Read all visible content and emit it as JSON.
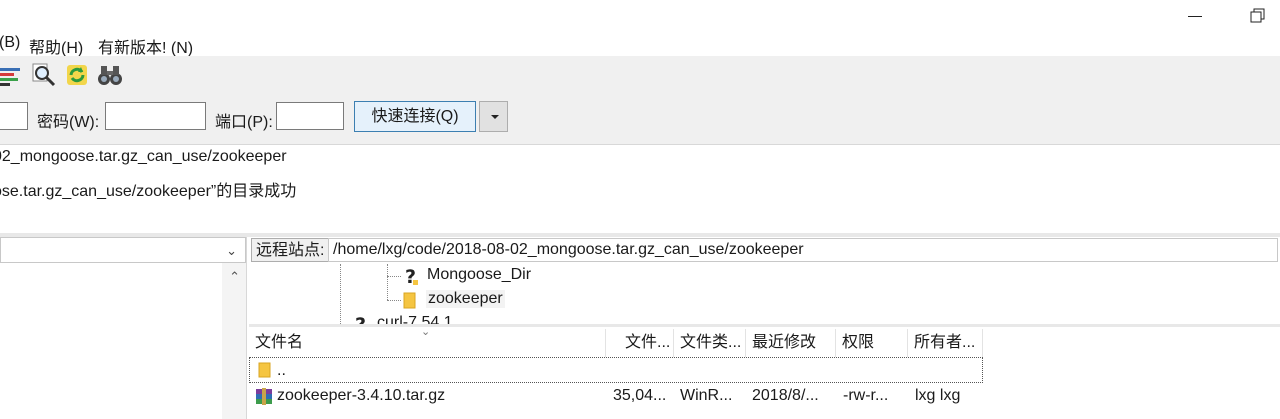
{
  "menu": {
    "items": [
      "(B)",
      "帮助(H)",
      "有新版本! (N)"
    ]
  },
  "toolbar": {
    "icons": [
      "filter-list-icon",
      "search-remote-icon",
      "refresh-icon",
      "find-binoculars-icon"
    ]
  },
  "quickconnect": {
    "password_label": "密码(W):",
    "port_label": "端口(P):",
    "connect_label": "快速连接(Q)",
    "host_value": "",
    "password_value": "",
    "port_value": ""
  },
  "log": {
    "lines": [
      "02_mongoose.tar.gz_can_use/zookeeper",
      "ose.tar.gz_can_use/zookeeper”的目录成功"
    ]
  },
  "remote": {
    "site_label": "远程站点:",
    "path": "/home/lxg/code/2018-08-02_mongoose.tar.gz_can_use/zookeeper",
    "tree": {
      "items": [
        {
          "label": "Mongoose_Dir",
          "icon": "unknown-folder-icon"
        },
        {
          "label": "zookeeper",
          "icon": "folder-icon"
        },
        {
          "label": "curl-7.54.1",
          "icon": "unknown-folder-icon"
        }
      ]
    },
    "columns": [
      "文件名",
      "文件...",
      "文件类...",
      "最近修改",
      "权限",
      "所有者..."
    ],
    "rows": [
      {
        "name": "..",
        "size": "",
        "type": "",
        "modified": "",
        "perms": "",
        "owner": "",
        "icon": "folder-icon"
      },
      {
        "name": "zookeeper-3.4.10.tar.gz",
        "size": "35,04...",
        "type": "WinR...",
        "modified": "2018/8/...",
        "perms": "-rw-r...",
        "owner": "lxg lxg",
        "icon": "archive-icon"
      }
    ]
  },
  "colors": {
    "toolbar_bg": "#f0f0f0",
    "connect_border": "#3c7fb1",
    "connect_bg": "#e5f1fb",
    "folder": "#f5c542"
  }
}
